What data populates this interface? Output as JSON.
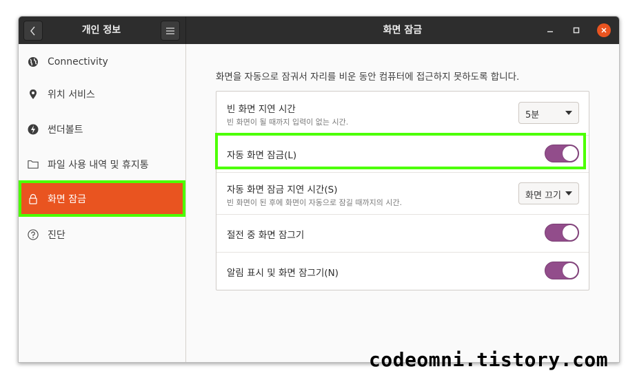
{
  "header": {
    "left_title": "개인 정보",
    "main_title": "화면 잠금"
  },
  "sidebar": {
    "items": [
      {
        "label": "Connectivity",
        "icon": "globe-icon"
      },
      {
        "label": "위치 서비스",
        "icon": "location-pin-icon"
      },
      {
        "label": "썬더볼트",
        "icon": "thunderbolt-icon"
      },
      {
        "label": "파일 사용 내역 및 휴지통",
        "icon": "folder-icon"
      },
      {
        "label": "화면 잠금",
        "icon": "lock-icon",
        "active": true
      },
      {
        "label": "진단",
        "icon": "help-circle-icon"
      }
    ]
  },
  "main": {
    "description": "화면을 자동으로 잠궈서 자리를 비운 동안 컴퓨터에 접근하지 못하도록 합니다.",
    "rows": [
      {
        "title": "빈 화면 지연 시간",
        "subtitle": "빈 화면이 될 때까지 입력이 없는 시간.",
        "control": "dropdown",
        "value": "5분"
      },
      {
        "title": "자동 화면 잠금(L)",
        "control": "switch",
        "on": true
      },
      {
        "title": "자동 화면 잠금 지연 시간(S)",
        "subtitle": "빈 화면이 된 후에 화면이 자동으로 잠길 때까지의 시간.",
        "control": "dropdown",
        "value": "화면 끄기"
      },
      {
        "title": "절전 중 화면 잠그기",
        "control": "switch",
        "on": true
      },
      {
        "title": "알림 표시 및 화면 잠그기(N)",
        "control": "switch",
        "on": true
      }
    ]
  },
  "watermark": "codeomni.tistory.com",
  "colors": {
    "accent": "#e95420",
    "switch_on": "#924d8b",
    "highlight": "#4cff00",
    "headerbar": "#2d2d2d"
  }
}
